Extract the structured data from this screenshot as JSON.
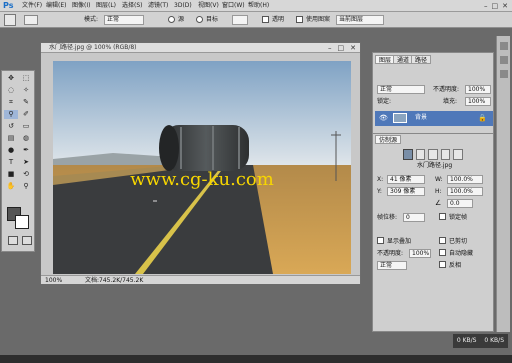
{
  "app": {
    "logo": "Ps"
  },
  "menu": [
    "文件(F)",
    "编辑(E)",
    "图像(I)",
    "图层(L)",
    "选择(S)",
    "滤镜(T)",
    "3D(D)",
    "视图(V)",
    "窗口(W)",
    "帮助(H)"
  ],
  "window_controls": [
    "–",
    "□",
    "✕"
  ],
  "options": {
    "mode_label": "模式:",
    "mode_value": "正常",
    "radio1": "源",
    "radio2": "目标",
    "transparent": "透明",
    "use_pattern": "使用图案",
    "sample_value": "当前图层"
  },
  "document": {
    "title": "水门路径.jpg @ 100% (RGB/8)",
    "zoom": "100%",
    "status": "文档:745.2K/745.2K",
    "watermark": "www.cg-ku.com",
    "controls": [
      "–",
      "□",
      "✕"
    ]
  },
  "panel": {
    "tabs": [
      "图层",
      "通道",
      "路径"
    ],
    "blend_mode": "正常",
    "opacity_label": "不透明度:",
    "opacity_value": "100%",
    "lock_label": "锁定:",
    "fill_label": "填充:",
    "fill_value": "100%",
    "layer_name": "背景",
    "clone_title": "仿制源",
    "clone_file": "水门路径.jpg",
    "offset_x_label": "X:",
    "offset_x": "41 像素",
    "offset_y_label": "Y:",
    "offset_y": "309 像素",
    "w_label": "W:",
    "w_value": "100.0%",
    "h_label": "H:",
    "h_value": "100.0%",
    "angle_value": "0.0",
    "frame_label": "帧位移:",
    "frame_value": "0",
    "lock_frame": "锁定帧",
    "show_overlay": "显示叠加",
    "overlay_opacity_label": "不透明度:",
    "overlay_opacity": "100%",
    "clipped": "已剪切",
    "auto_hide": "自动隐藏",
    "invert": "反相",
    "normal_label": "正常"
  },
  "taskbar": {
    "left": "0 KB/S",
    "right": "0 KB/S"
  },
  "colors": {
    "accent": "#4f78b9",
    "sky_top": "#87a8c8",
    "sky_bottom": "#dfe6ea",
    "road": "#3a3c3e",
    "grass": "#c89a4c",
    "watermark": "#f7d600"
  }
}
